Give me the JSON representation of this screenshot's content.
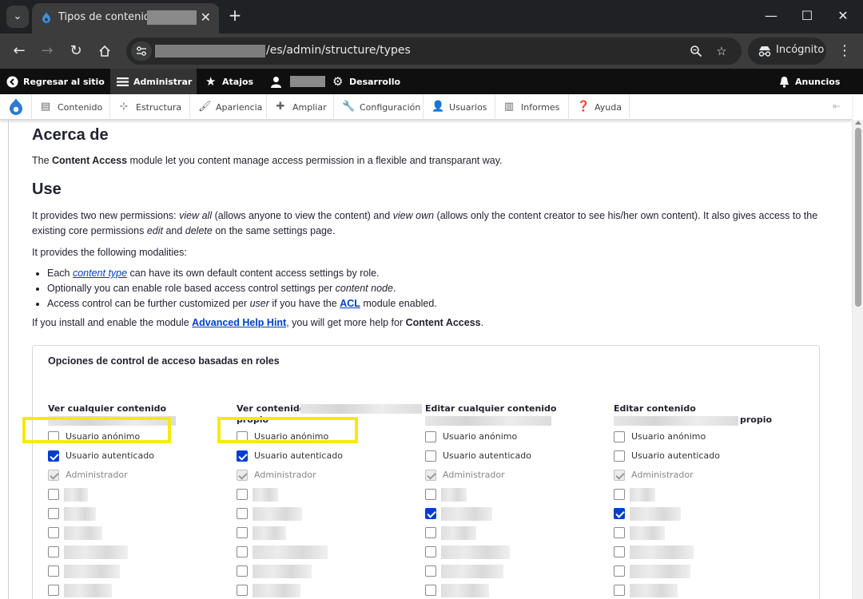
{
  "browser": {
    "tab": {
      "title": "Tipos de contenido |"
    },
    "omnibox": {
      "url_visible": "/es/admin/structure/types"
    },
    "incognito_label": "Incógnito"
  },
  "admin_toolbar": {
    "back_to_site": "Regresar al sitio",
    "manage": "Administrar",
    "shortcuts": "Atajos",
    "develop": "Desarrollo",
    "announcements": "Anuncios"
  },
  "admin_tray": {
    "items": [
      {
        "label": "Contenido",
        "icon": "document-icon"
      },
      {
        "label": "Estructura",
        "icon": "sitemap-icon"
      },
      {
        "label": "Apariencia",
        "icon": "brush-icon"
      },
      {
        "label": "Ampliar",
        "icon": "puzzle-icon"
      },
      {
        "label": "Configuración",
        "icon": "wrench-icon"
      },
      {
        "label": "Usuarios",
        "icon": "users-icon"
      },
      {
        "label": "Informes",
        "icon": "bar-chart-icon"
      },
      {
        "label": "Ayuda",
        "icon": "help-icon"
      }
    ]
  },
  "content": {
    "about_heading": "Acerca de",
    "about": {
      "pre": "The ",
      "module": "Content Access",
      "post": " module let you content manage access permission in a flexible and transparant way."
    },
    "use_heading": "Use",
    "use_p1": {
      "a": "It provides two new permissions: ",
      "b": "view all",
      "c": " (allows anyone to view the content) and ",
      "d": "view own",
      "e": " (allows only the content creator to see his/her own content). It also gives access to the existing core permissions ",
      "f": "edit",
      "g": " and ",
      "h": "delete",
      "i": " on the same settings page."
    },
    "use_p2": "It provides the following modalities:",
    "bullets": {
      "b1": {
        "pre": "Each ",
        "link": "content type",
        "post": " can have its own default content access settings by role."
      },
      "b2": {
        "pre": "Optionally you can enable role based access control settings per ",
        "em": "content node",
        "post": "."
      },
      "b3": {
        "pre": "Access control can be further customized per ",
        "em": "user",
        "mid": " if you have the ",
        "link": "ACL",
        "post": " module enabled."
      }
    },
    "hint": {
      "pre": "If you install and enable the module ",
      "link": "Advanced Help Hint",
      "mid": ", you will get more help for ",
      "strong": "Content Access",
      "post": "."
    }
  },
  "roles_fieldset": {
    "legend": "Opciones de control de acceso basadas en roles",
    "columns": [
      {
        "title": "Ver cualquier contenido",
        "suffix": ""
      },
      {
        "title": "Ver contenido",
        "suffix": "propio"
      },
      {
        "title": "Editar cualquier contenido",
        "suffix": ""
      },
      {
        "title": "Editar contenido",
        "suffix": "propio"
      }
    ],
    "role_labels": {
      "anonymous": "Usuario anónimo",
      "authenticated": "Usuario autenticado",
      "administrator": "Administrador"
    }
  }
}
